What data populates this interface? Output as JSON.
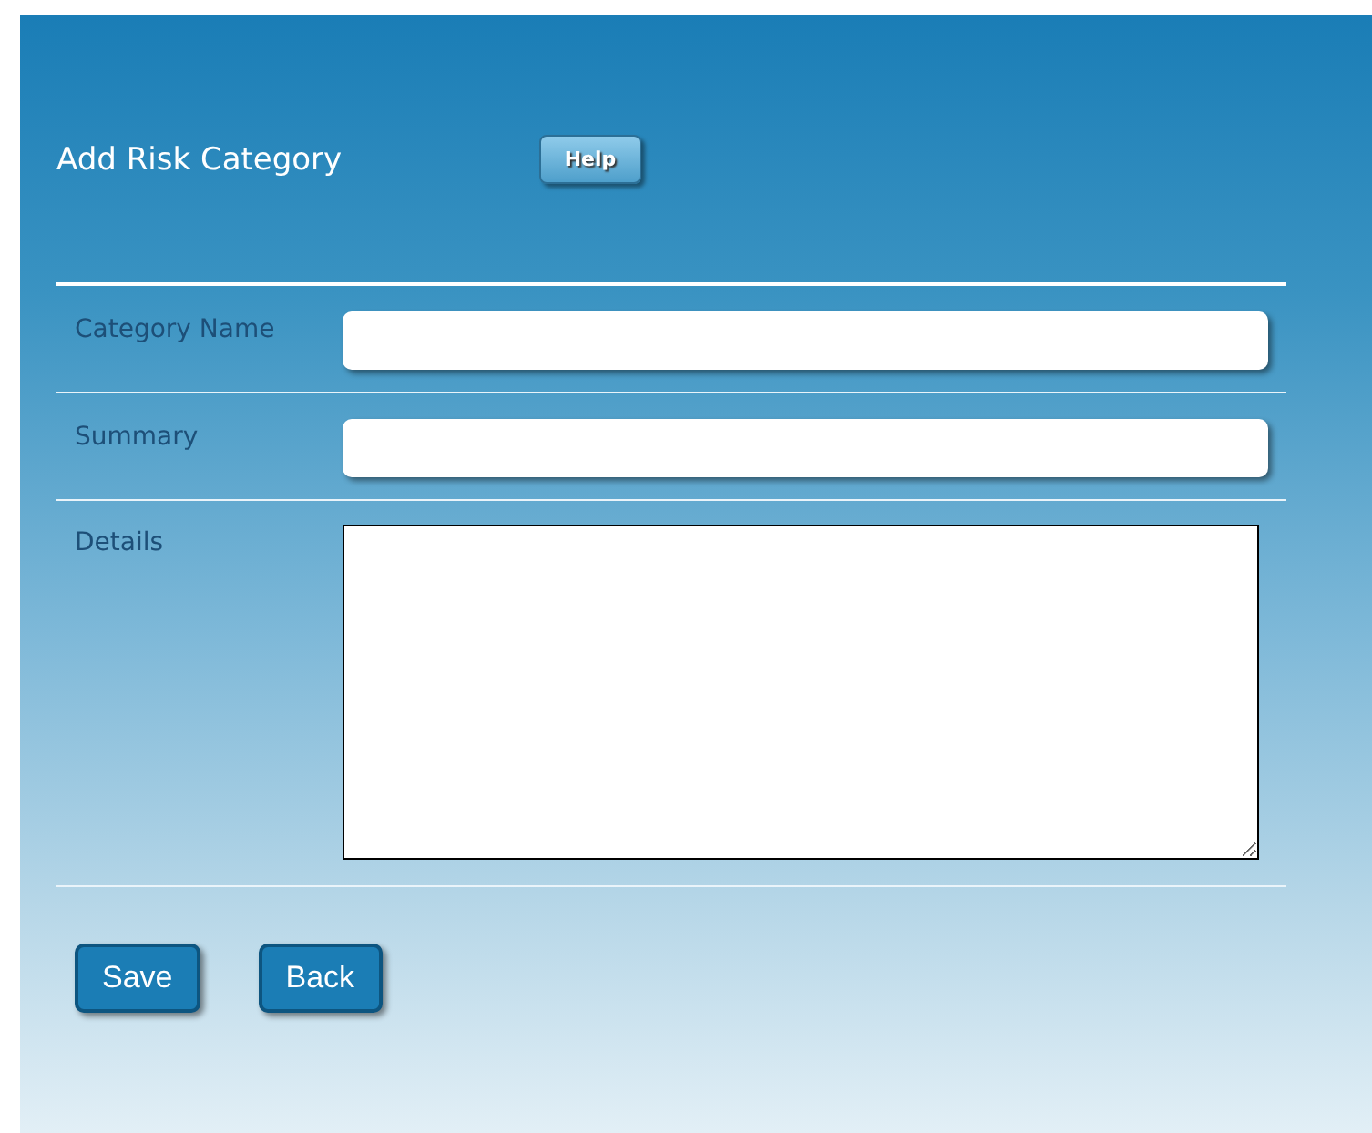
{
  "title": "Add Risk Category",
  "help_button": "Help",
  "fields": [
    {
      "label": "Category Name",
      "kind": "text"
    },
    {
      "label": "Summary",
      "kind": "text"
    },
    {
      "label": "Details",
      "kind": "textarea"
    }
  ],
  "buttons": [
    "Save",
    "Back"
  ]
}
